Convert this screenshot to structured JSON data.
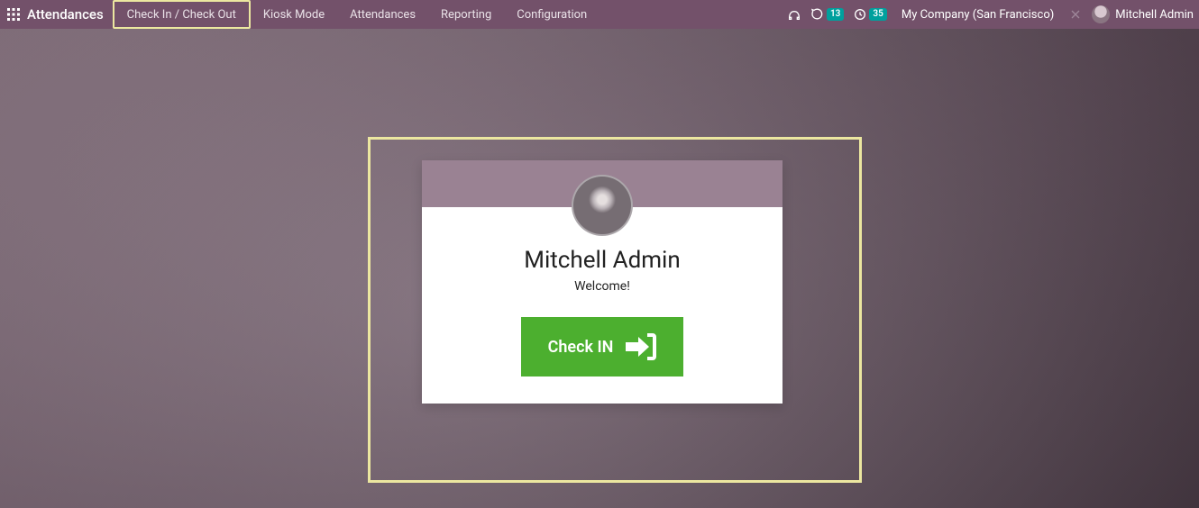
{
  "app": {
    "title": "Attendances"
  },
  "nav": {
    "items": [
      {
        "label": "Check In / Check Out",
        "active": true
      },
      {
        "label": "Kiosk Mode"
      },
      {
        "label": "Attendances"
      },
      {
        "label": "Reporting"
      },
      {
        "label": "Configuration"
      }
    ]
  },
  "systray": {
    "messages_badge": "13",
    "activities_badge": "35",
    "company": "My Company (San Francisco)",
    "user": "Mitchell Admin"
  },
  "card": {
    "name": "Mitchell Admin",
    "subtitle": "Welcome!",
    "button_label": "Check IN"
  }
}
